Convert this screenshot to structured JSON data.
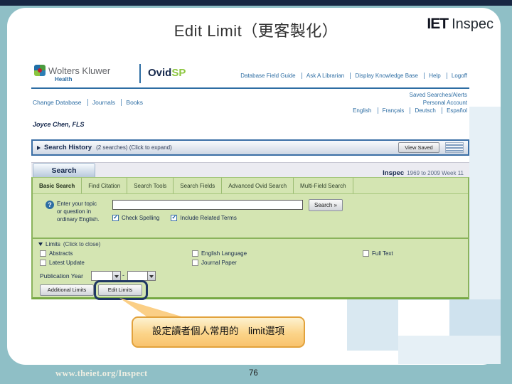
{
  "slide": {
    "title": "Edit Limit（更客製化）",
    "logo_iet": "IET",
    "logo_inspec": "Inspec",
    "callout_text": "設定讀者個人常用的　limit選項",
    "footer_url": "www.theiet.org/Inspect",
    "page_number": "76"
  },
  "shot": {
    "brand": {
      "wolters_kluwer": "Wolters Kluwer",
      "health": "Health",
      "ovid": "Ovid",
      "sp": "SP"
    },
    "top_links": [
      "Database Field Guide",
      "Ask A Librarian",
      "Display Knowledge Base",
      "Help",
      "Logoff"
    ],
    "nav_links": [
      "Change Database",
      "Journals",
      "Books"
    ],
    "account_links": [
      "Saved Searches/Alerts",
      "Personal Account"
    ],
    "languages": [
      "English",
      "Français",
      "Deutsch",
      "Español"
    ],
    "user_name": "Joyce Chen, FLS",
    "history": {
      "title": "Search History",
      "meta": "(2 searches) (Click to expand)",
      "view_saved": "View Saved"
    },
    "panel": {
      "tab": "Search",
      "db_name": "Inspec",
      "db_range": "1969 to 2009 Week 11",
      "tabs": [
        "Basic Search",
        "Find Citation",
        "Search Tools",
        "Search Fields",
        "Advanced Ovid Search",
        "Multi-Field Search"
      ],
      "prompt_line1": "Enter your topic",
      "prompt_line2": "or question in",
      "prompt_line3": "ordinary English.",
      "search_button": "Search »",
      "check_spelling": "Check Spelling",
      "include_related": "Include Related Terms"
    },
    "limits": {
      "title": "Limits",
      "meta": "(Click to close)",
      "options_col1": [
        "Abstracts",
        "Latest Update"
      ],
      "options_col2": [
        "English Language",
        "Journal Paper"
      ],
      "options_col3": [
        "Full Text"
      ],
      "publication_year_label": "Publication Year",
      "range_separator": "-",
      "additional_limits_button": "Additional Limits",
      "edit_limits_button": "Edit Limits"
    }
  },
  "colors": {
    "teal_frame": "#8fbfc6",
    "navy_bar": "#182743",
    "link_blue": "#2d6da3",
    "panel_green": "#d4e5b2",
    "green_border": "#8ab35c",
    "callout_border": "#e2a23c",
    "ovid_green": "#8dc63f"
  }
}
